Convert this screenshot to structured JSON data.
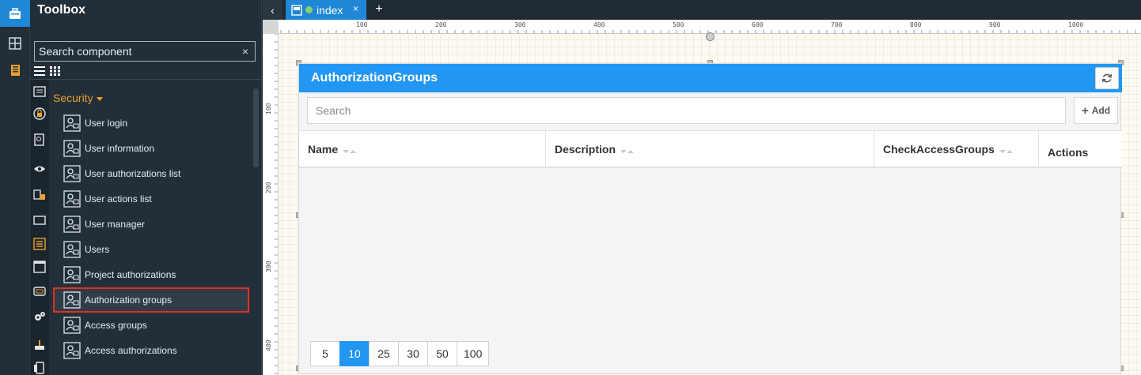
{
  "rail": {
    "items": [
      {
        "icon": "toolbox-icon",
        "active": true
      },
      {
        "icon": "layout-icon",
        "active": false
      },
      {
        "icon": "notebook-icon",
        "active": false
      }
    ]
  },
  "toolbox": {
    "title": "Toolbox",
    "search_placeholder": "Search component",
    "clear_symbol": "×",
    "category": "Security",
    "category_icons": [
      "list-icon",
      "lock-icon",
      "report-icon",
      "eye-icon",
      "book-icon",
      "panel-icon",
      "list-orange-icon",
      "window-icon",
      "card-icon",
      "gears-icon",
      "tool-icon",
      "phone-icon"
    ],
    "items": [
      {
        "label": "User login",
        "icon": "user-login-icon"
      },
      {
        "label": "User information",
        "icon": "user-info-icon"
      },
      {
        "label": "User authorizations list",
        "icon": "user-auth-list-icon"
      },
      {
        "label": "User actions list",
        "icon": "user-actions-list-icon"
      },
      {
        "label": "User manager",
        "icon": "user-manager-icon"
      },
      {
        "label": "Users",
        "icon": "users-icon"
      },
      {
        "label": "Project authorizations",
        "icon": "project-auth-icon"
      },
      {
        "label": "Authorization groups",
        "icon": "auth-groups-icon",
        "selected": true
      },
      {
        "label": "Access groups",
        "icon": "access-groups-icon"
      },
      {
        "label": "Access authorizations",
        "icon": "access-auth-icon"
      }
    ]
  },
  "tabs": {
    "back_symbol": "‹",
    "active_tab": "index",
    "close_symbol": "×",
    "add_symbol": "+"
  },
  "ruler": {
    "top_labels": [
      "100",
      "200",
      "300",
      "400",
      "500",
      "600",
      "700",
      "800",
      "900",
      "1000"
    ],
    "left_labels": [
      "100",
      "200",
      "300",
      "400"
    ]
  },
  "widget": {
    "title": "AuthorizationGroups",
    "search_placeholder": "Search",
    "add_label": "Add",
    "columns": [
      "Name",
      "Description",
      "CheckAccessGroups",
      "Actions"
    ],
    "page_sizes": [
      "5",
      "10",
      "25",
      "30",
      "50",
      "100"
    ],
    "active_page_size": "10"
  },
  "colors": {
    "accent": "#2196f3",
    "tab_active": "#1e88d6",
    "category": "#f0a030",
    "selection_border": "#e0302a"
  }
}
